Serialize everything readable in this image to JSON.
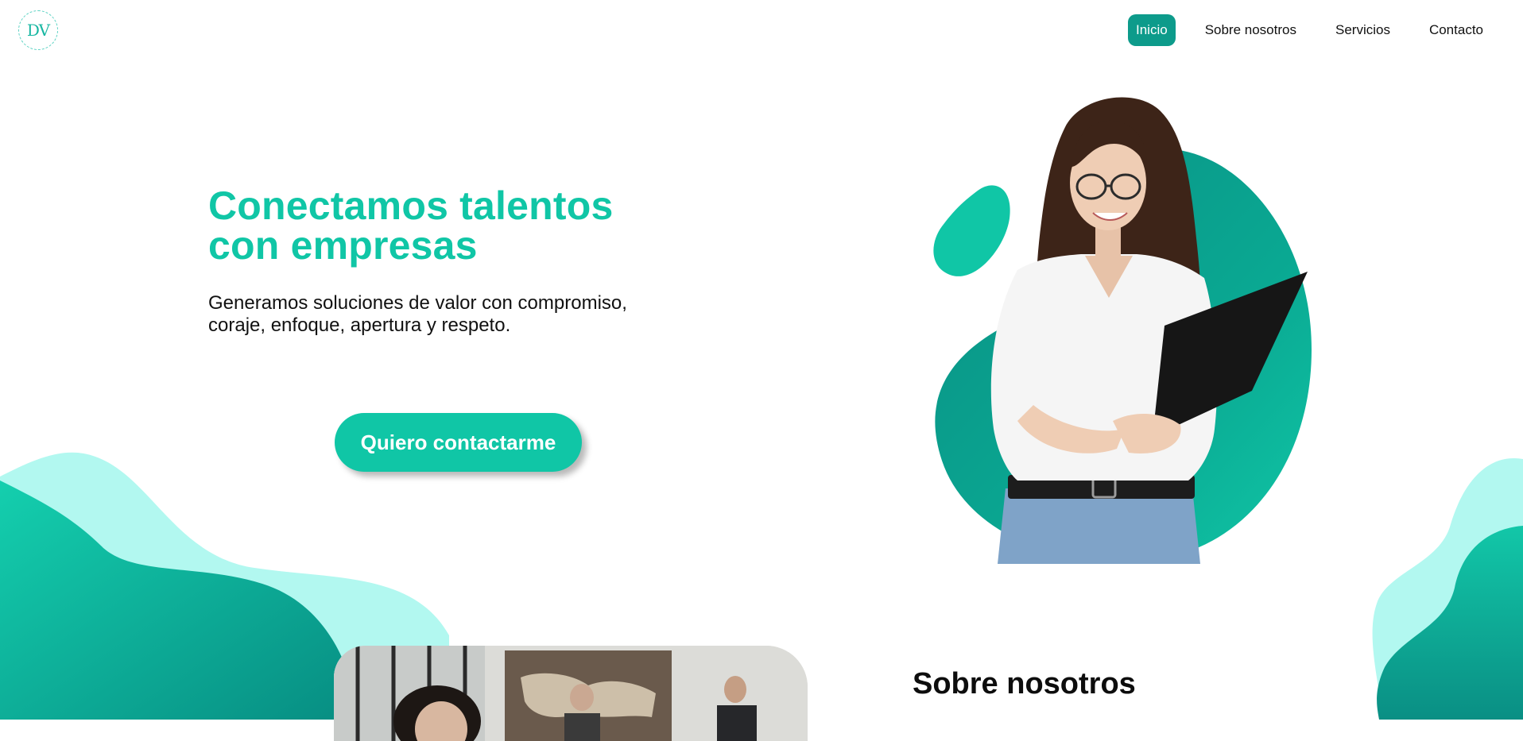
{
  "brand": {
    "logo_text": "DV"
  },
  "nav": {
    "items": [
      {
        "label": "Inicio",
        "active": true
      },
      {
        "label": "Sobre nosotros",
        "active": false
      },
      {
        "label": "Servicios",
        "active": false
      },
      {
        "label": "Contacto",
        "active": false
      }
    ]
  },
  "hero": {
    "title_line1": "Conectamos talentos",
    "title_line2": "con empresas",
    "subtitle": "Generamos soluciones de valor con compromiso, coraje, enfoque, apertura y respeto.",
    "cta_label": "Quiero contactarme"
  },
  "about": {
    "title": "Sobre nosotros"
  },
  "colors": {
    "accent": "#10c6a6",
    "accent_dark": "#0d9b8b",
    "mint_light": "#b2f8f0"
  }
}
